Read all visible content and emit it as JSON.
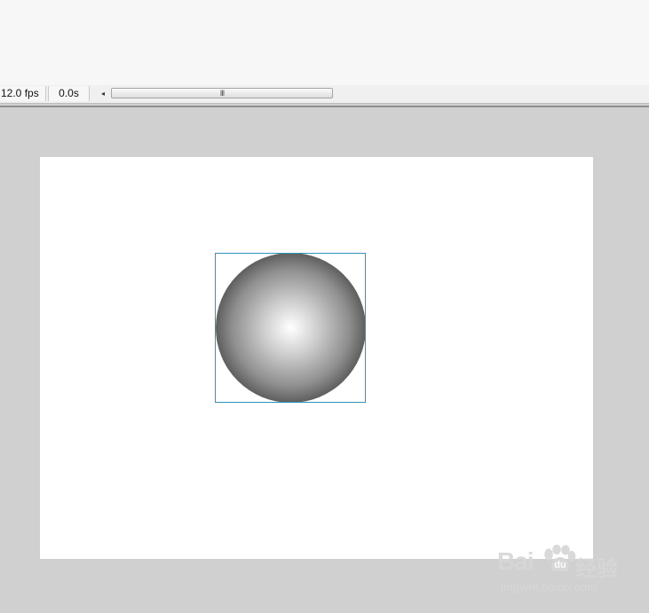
{
  "timeline": {
    "fps_label": "12.0 fps",
    "time_label": "0.0s",
    "scroll_left_glyph": "◂",
    "scroll_grip_glyph": "III"
  },
  "stage": {
    "background": "#ffffff",
    "pasteboard_color": "#d0d0d0",
    "object": {
      "type": "radial-gradient-circle",
      "center_color": "#ffffff",
      "edge_color": "#050505",
      "selection_color": "#2f95b8"
    }
  },
  "watermark": {
    "brand_left": "Bai",
    "brand_right": "经验",
    "url": "jingyan.baidu.com",
    "icon": "paw-icon"
  }
}
